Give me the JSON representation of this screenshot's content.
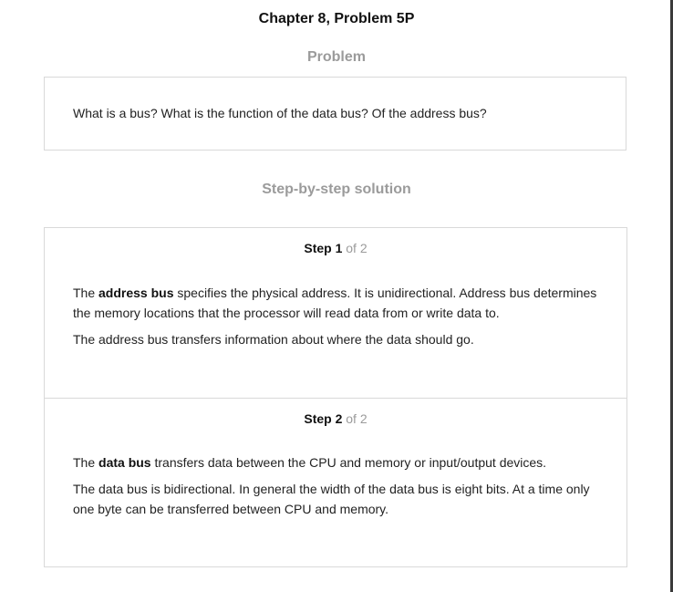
{
  "header": {
    "title": "Chapter 8, Problem 5P"
  },
  "problem": {
    "heading": "Problem",
    "text": "What is a bus? What is the function of the data bus? Of the address bus?"
  },
  "solution": {
    "heading": "Step-by-step solution",
    "steps": [
      {
        "label": "Step 1",
        "of": "of 2",
        "paragraphs": [
          {
            "pre": "The ",
            "bold": "address bus",
            "post": " specifies the physical address. It is unidirectional. Address bus determines the memory locations that the processor will read data from or write data to."
          },
          {
            "text": "The address bus transfers information about where the data should go."
          }
        ]
      },
      {
        "label": "Step 2",
        "of": "of 2",
        "paragraphs": [
          {
            "pre": "The ",
            "bold": "data bus",
            "post": " transfers data between the CPU and memory or input/output devices."
          },
          {
            "text": "The data bus is bidirectional. In general the width of the data bus is eight bits. At a time only one byte can be transferred between CPU and memory."
          }
        ]
      }
    ]
  }
}
